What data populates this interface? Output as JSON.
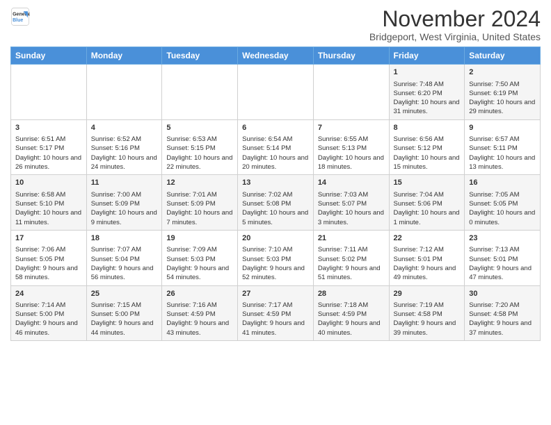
{
  "header": {
    "logo_line1": "General",
    "logo_line2": "Blue",
    "month_title": "November 2024",
    "subtitle": "Bridgeport, West Virginia, United States"
  },
  "weekdays": [
    "Sunday",
    "Monday",
    "Tuesday",
    "Wednesday",
    "Thursday",
    "Friday",
    "Saturday"
  ],
  "weeks": [
    [
      {
        "day": "",
        "info": ""
      },
      {
        "day": "",
        "info": ""
      },
      {
        "day": "",
        "info": ""
      },
      {
        "day": "",
        "info": ""
      },
      {
        "day": "",
        "info": ""
      },
      {
        "day": "1",
        "info": "Sunrise: 7:48 AM\nSunset: 6:20 PM\nDaylight: 10 hours and 31 minutes."
      },
      {
        "day": "2",
        "info": "Sunrise: 7:50 AM\nSunset: 6:19 PM\nDaylight: 10 hours and 29 minutes."
      }
    ],
    [
      {
        "day": "3",
        "info": "Sunrise: 6:51 AM\nSunset: 5:17 PM\nDaylight: 10 hours and 26 minutes."
      },
      {
        "day": "4",
        "info": "Sunrise: 6:52 AM\nSunset: 5:16 PM\nDaylight: 10 hours and 24 minutes."
      },
      {
        "day": "5",
        "info": "Sunrise: 6:53 AM\nSunset: 5:15 PM\nDaylight: 10 hours and 22 minutes."
      },
      {
        "day": "6",
        "info": "Sunrise: 6:54 AM\nSunset: 5:14 PM\nDaylight: 10 hours and 20 minutes."
      },
      {
        "day": "7",
        "info": "Sunrise: 6:55 AM\nSunset: 5:13 PM\nDaylight: 10 hours and 18 minutes."
      },
      {
        "day": "8",
        "info": "Sunrise: 6:56 AM\nSunset: 5:12 PM\nDaylight: 10 hours and 15 minutes."
      },
      {
        "day": "9",
        "info": "Sunrise: 6:57 AM\nSunset: 5:11 PM\nDaylight: 10 hours and 13 minutes."
      }
    ],
    [
      {
        "day": "10",
        "info": "Sunrise: 6:58 AM\nSunset: 5:10 PM\nDaylight: 10 hours and 11 minutes."
      },
      {
        "day": "11",
        "info": "Sunrise: 7:00 AM\nSunset: 5:09 PM\nDaylight: 10 hours and 9 minutes."
      },
      {
        "day": "12",
        "info": "Sunrise: 7:01 AM\nSunset: 5:09 PM\nDaylight: 10 hours and 7 minutes."
      },
      {
        "day": "13",
        "info": "Sunrise: 7:02 AM\nSunset: 5:08 PM\nDaylight: 10 hours and 5 minutes."
      },
      {
        "day": "14",
        "info": "Sunrise: 7:03 AM\nSunset: 5:07 PM\nDaylight: 10 hours and 3 minutes."
      },
      {
        "day": "15",
        "info": "Sunrise: 7:04 AM\nSunset: 5:06 PM\nDaylight: 10 hours and 1 minute."
      },
      {
        "day": "16",
        "info": "Sunrise: 7:05 AM\nSunset: 5:05 PM\nDaylight: 10 hours and 0 minutes."
      }
    ],
    [
      {
        "day": "17",
        "info": "Sunrise: 7:06 AM\nSunset: 5:05 PM\nDaylight: 9 hours and 58 minutes."
      },
      {
        "day": "18",
        "info": "Sunrise: 7:07 AM\nSunset: 5:04 PM\nDaylight: 9 hours and 56 minutes."
      },
      {
        "day": "19",
        "info": "Sunrise: 7:09 AM\nSunset: 5:03 PM\nDaylight: 9 hours and 54 minutes."
      },
      {
        "day": "20",
        "info": "Sunrise: 7:10 AM\nSunset: 5:03 PM\nDaylight: 9 hours and 52 minutes."
      },
      {
        "day": "21",
        "info": "Sunrise: 7:11 AM\nSunset: 5:02 PM\nDaylight: 9 hours and 51 minutes."
      },
      {
        "day": "22",
        "info": "Sunrise: 7:12 AM\nSunset: 5:01 PM\nDaylight: 9 hours and 49 minutes."
      },
      {
        "day": "23",
        "info": "Sunrise: 7:13 AM\nSunset: 5:01 PM\nDaylight: 9 hours and 47 minutes."
      }
    ],
    [
      {
        "day": "24",
        "info": "Sunrise: 7:14 AM\nSunset: 5:00 PM\nDaylight: 9 hours and 46 minutes."
      },
      {
        "day": "25",
        "info": "Sunrise: 7:15 AM\nSunset: 5:00 PM\nDaylight: 9 hours and 44 minutes."
      },
      {
        "day": "26",
        "info": "Sunrise: 7:16 AM\nSunset: 4:59 PM\nDaylight: 9 hours and 43 minutes."
      },
      {
        "day": "27",
        "info": "Sunrise: 7:17 AM\nSunset: 4:59 PM\nDaylight: 9 hours and 41 minutes."
      },
      {
        "day": "28",
        "info": "Sunrise: 7:18 AM\nSunset: 4:59 PM\nDaylight: 9 hours and 40 minutes."
      },
      {
        "day": "29",
        "info": "Sunrise: 7:19 AM\nSunset: 4:58 PM\nDaylight: 9 hours and 39 minutes."
      },
      {
        "day": "30",
        "info": "Sunrise: 7:20 AM\nSunset: 4:58 PM\nDaylight: 9 hours and 37 minutes."
      }
    ]
  ]
}
